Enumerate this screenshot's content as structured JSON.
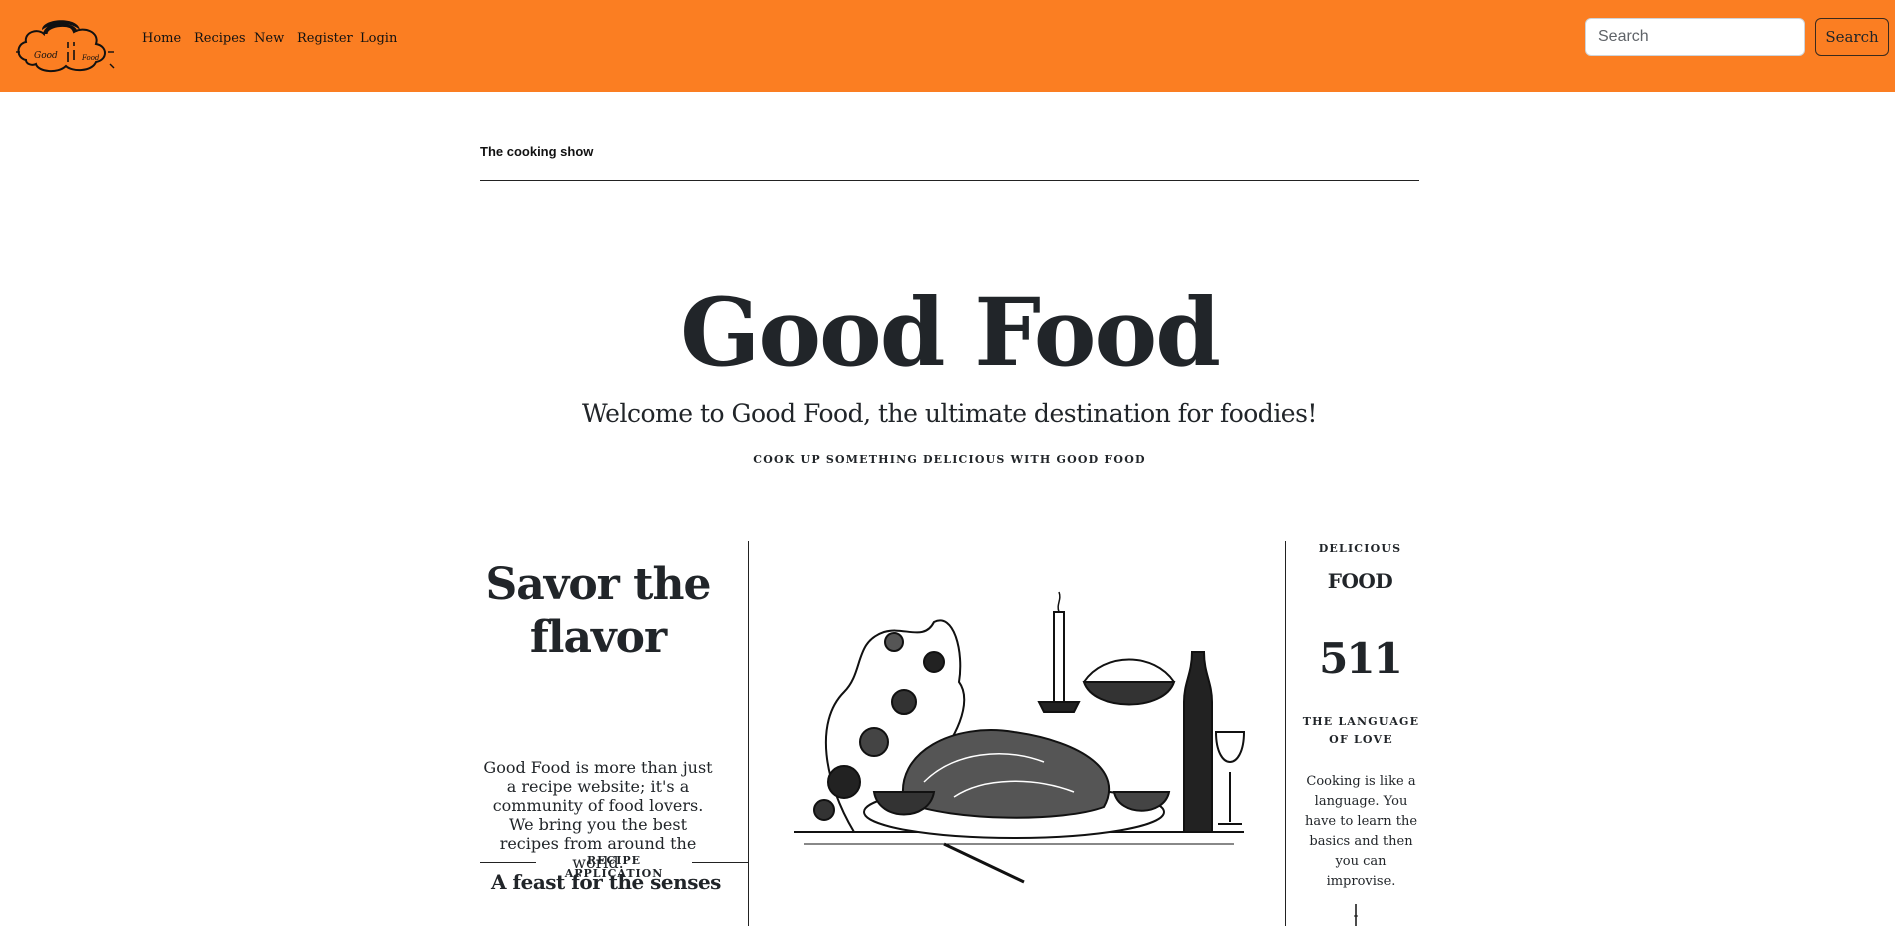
{
  "nav": {
    "logo_text": [
      "Good",
      "Food"
    ],
    "links": [
      "Home",
      "Recipes",
      "New",
      "Register",
      "Login"
    ],
    "search_placeholder": "Search",
    "search_button": "Search"
  },
  "header": {
    "show_label": "The cooking show"
  },
  "hero": {
    "title": "Good Food",
    "lead": "Welcome to Good Food, the ultimate destination for foodies!",
    "tagline": "COOK UP SOMETHING DELICIOUS WITH GOOD FOOD"
  },
  "left": {
    "heading": "Savor the flavor",
    "intro": "Good Food is more than just a recipe website; it's a community of food lovers. We bring you the best recipes from around the world.",
    "section_label": "RECIPE APPLICATION",
    "subheading": "A feast for the senses"
  },
  "right": {
    "kicker": "DELICIOUS",
    "word": "FOOD",
    "count": "511",
    "caption": "THE LANGUAGE OF LOVE",
    "quote": "Cooking is like a language. You have to learn the basics and then you can improvise."
  },
  "colors": {
    "navbar": "#fb7e22",
    "text": "#212529"
  }
}
